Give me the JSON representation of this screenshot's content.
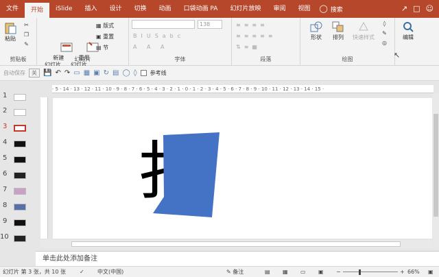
{
  "tabs": {
    "items": [
      "文件",
      "开始",
      "iSlide",
      "插入",
      "设计",
      "切换",
      "动画",
      "口袋动画 PA",
      "幻灯片放映",
      "审阅",
      "视图"
    ],
    "search": "搜索"
  },
  "ribbon": {
    "paste": "粘贴",
    "new_slide": "新建\n幻灯片",
    "reuse_slides": "重用\n幻灯片",
    "layout": "版式",
    "reset": "重置",
    "section": "节",
    "font_placeholder": "",
    "font_size": "138",
    "shape": "形状",
    "arrange": "排列",
    "quick_styles": "快速样式",
    "edit": "编辑",
    "groups": {
      "clipboard": "剪贴板",
      "slides": "幻灯片",
      "font": "字体",
      "paragraph": "段落",
      "drawing": "绘图"
    }
  },
  "qat": {
    "autosave": "自动保存",
    "autosave_state": "关",
    "guides": "参考线"
  },
  "ruler": {
    "ticks": "· 5 · 14 · 13 · 12 · 11 · 10 · 9 · 8 · 7 · 6 · 5 · 4 · 3 · 2 · 1 · 0 · 1 · 2 · 3 · 4 · 5 · 6 · 7 · 8 · 9 · 10 · 11 · 12 · 13 · 14 · 15 ·"
  },
  "thumbnails": [
    "1",
    "2",
    "3",
    "4",
    "5",
    "6",
    "7",
    "8",
    "9",
    "10"
  ],
  "slide": {
    "glyph": "扌"
  },
  "notes": {
    "placeholder": "单击此处添加备注"
  },
  "status": {
    "slide_info": "幻灯片 第 3 张，共 10 张",
    "language": "中文(中国)",
    "notes": "备注",
    "zoom": "66%"
  },
  "colors": {
    "accent": "#b7472a",
    "shape_fill": "#4472c4"
  }
}
